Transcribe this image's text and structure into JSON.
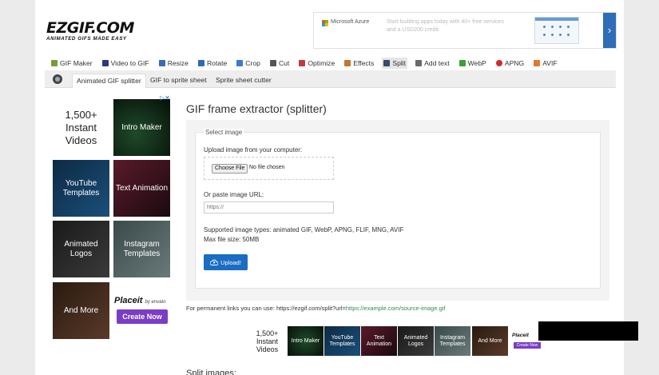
{
  "header": {
    "logo_text": "EZGIF.COM",
    "logo_tagline": "ANIMATED GIFS MADE EASY"
  },
  "top_ad": {
    "brand": "Microsoft Azure",
    "copy": "Start building apps today with 40+ free services and a USD200 credit",
    "arrow": "›",
    "badge": "▷✕"
  },
  "nav": {
    "items": [
      {
        "label": "GIF Maker",
        "icon": "gif-maker-icon",
        "color": "#7a9a3a"
      },
      {
        "label": "Video to GIF",
        "icon": "video-icon",
        "color": "#2a3a7a"
      },
      {
        "label": "Resize",
        "icon": "resize-icon",
        "color": "#3a6ab0"
      },
      {
        "label": "Rotate",
        "icon": "rotate-icon",
        "color": "#2a6ac0"
      },
      {
        "label": "Crop",
        "icon": "crop-icon",
        "color": "#3a7ad0"
      },
      {
        "label": "Cut",
        "icon": "cut-icon",
        "color": "#555555"
      },
      {
        "label": "Optimize",
        "icon": "optimize-icon",
        "color": "#c03a3a"
      },
      {
        "label": "Effects",
        "icon": "effects-icon",
        "color": "#c07a2a"
      },
      {
        "label": "Split",
        "icon": "split-icon",
        "color": "#3a4a6a"
      },
      {
        "label": "Add text",
        "icon": "add-text-icon",
        "color": "#6a6a6a"
      },
      {
        "label": "WebP",
        "icon": "webp-icon",
        "color": "#3aa03a"
      },
      {
        "label": "APNG",
        "icon": "apng-icon",
        "color": "#d02a2a"
      },
      {
        "label": "AVIF",
        "icon": "avif-icon",
        "color": "#e07a2a"
      }
    ],
    "active": "Split"
  },
  "subnav": {
    "tabs": [
      "Animated GIF splitter",
      "GIF to sprite sheet",
      "Sprite sheet cutter"
    ]
  },
  "left_ads": {
    "tiles": [
      "1,500+ Instant Videos",
      "Intro Maker",
      "YouTube Templates",
      "Text Animation",
      "Animated Logos",
      "Instagram Templates",
      "And More"
    ],
    "brand": "Placeit",
    "brand_by": "by envato",
    "button": "Create Now",
    "close": "▷✕"
  },
  "main": {
    "title": "GIF frame extractor (splitter)",
    "legend": "Select image",
    "upload_label": "Upload image from your computer:",
    "choose_file": "Choose File",
    "no_file": "No file chosen",
    "url_label": "Or paste image URL:",
    "url_placeholder": "https://",
    "supported": "Supported image types: animated GIF, WebP, APNG, FLIF, MNG, AVIF",
    "max_size": "Max file size: 50MB",
    "upload_button": "Upload!",
    "perm_text": "For permanent links you can use: https://ezgif.com/split?url=",
    "perm_link": "https://example.com/source-image.gif",
    "split_heading": "Split images:"
  },
  "bottom_ads": {
    "tiles": [
      "1,500+ Instant Videos",
      "Intro Maker",
      "YouTube Templates",
      "Text Animation",
      "Animated Logos",
      "Instagram Templates",
      "And More"
    ],
    "brand": "Placeit",
    "button": "Create Now"
  }
}
